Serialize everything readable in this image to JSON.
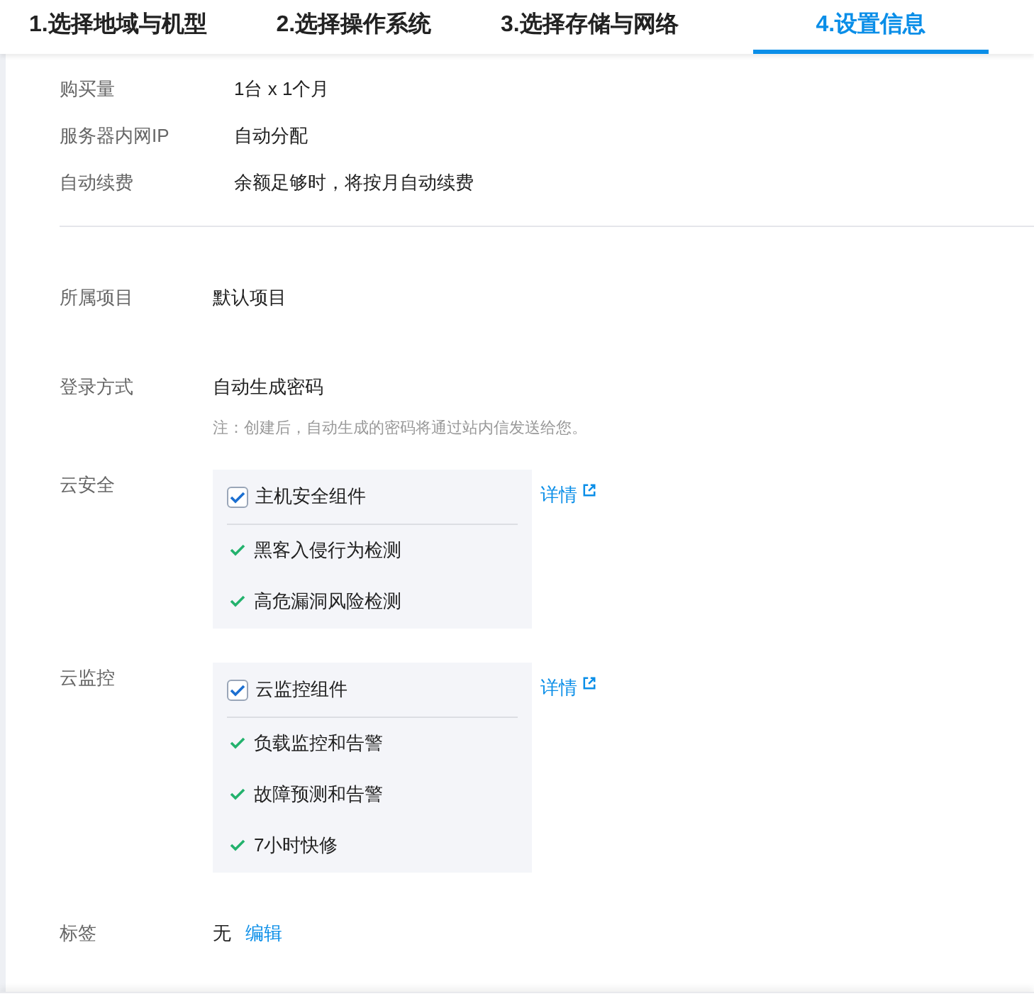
{
  "steps": [
    {
      "label": "1.选择地域与机型",
      "selected": false
    },
    {
      "label": "2.选择操作系统",
      "selected": false
    },
    {
      "label": "3.选择存储与网络",
      "selected": false
    },
    {
      "label": "4.设置信息",
      "selected": true
    }
  ],
  "summary": [
    {
      "label": "购买量",
      "value": "1台 x 1个月"
    },
    {
      "label": "服务器内网IP",
      "value": "自动分配"
    },
    {
      "label": "自动续费",
      "value": "余额足够时，将按月自动续费"
    }
  ],
  "project": {
    "label": "所属项目",
    "value": "默认项目"
  },
  "login": {
    "label": "登录方式",
    "value": "自动生成密码",
    "note": "注：创建后，自动生成的密码将通过站内信发送给您。"
  },
  "services": [
    {
      "label": "云安全",
      "component": "主机安全组件",
      "checked": true,
      "link": "详情",
      "features": [
        "黑客入侵行为检测",
        "高危漏洞风险检测"
      ]
    },
    {
      "label": "云监控",
      "component": "云监控组件",
      "checked": true,
      "link": "详情",
      "features": [
        "负载监控和告警",
        "故障预测和告警",
        "7小时快修"
      ]
    }
  ],
  "tags": {
    "label": "标签",
    "value": "无",
    "action": "编辑"
  }
}
